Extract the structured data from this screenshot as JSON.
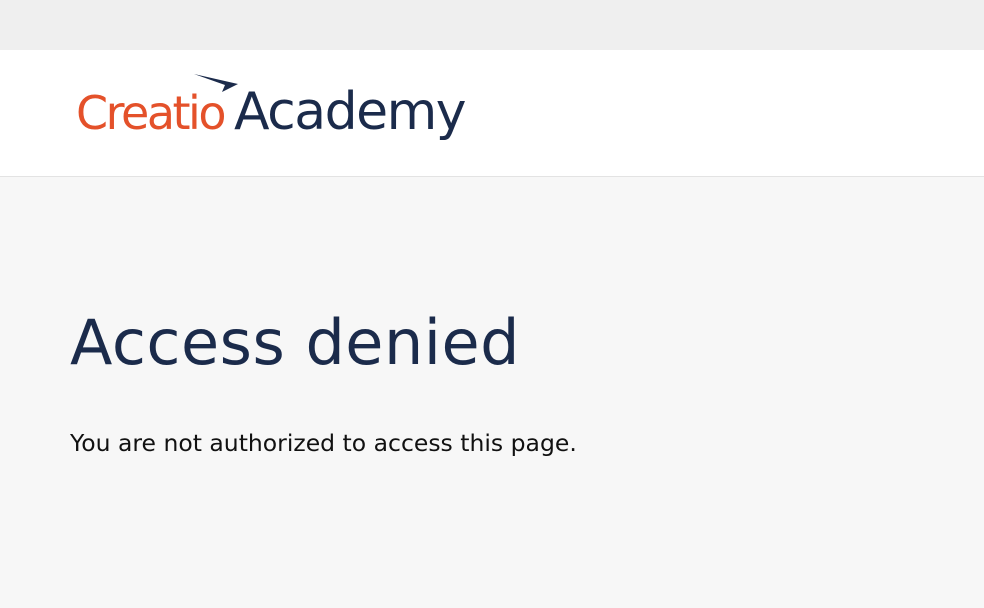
{
  "colors": {
    "brand_orange": "#e4512a",
    "brand_navy": "#1b2b4b",
    "header_bg": "#ffffff",
    "page_bg": "#f7f7f7",
    "top_strip_bg": "#efefef"
  },
  "header": {
    "logo": {
      "creatio": "Creatio",
      "academy": "Academy",
      "swoosh_icon": "swoosh-icon"
    }
  },
  "main": {
    "title": "Access denied",
    "message": "You are not authorized to access this page."
  }
}
